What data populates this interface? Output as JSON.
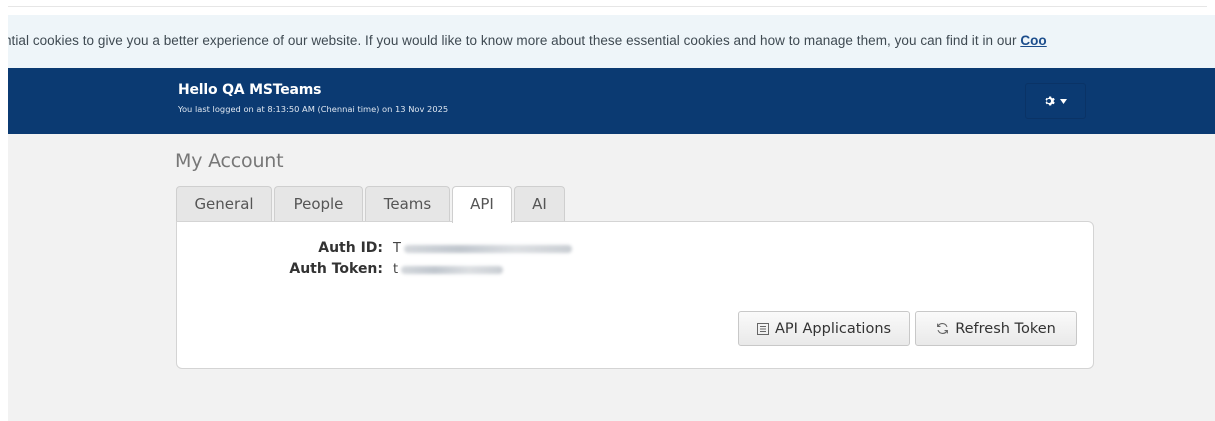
{
  "cookie_banner": {
    "text": "ntial cookies to give you a better experience of our website. If you would like to know more about these essential cookies and how to manage them, you can find it in our ",
    "link_text": "Coo"
  },
  "header": {
    "greeting": "Hello QA MSTeams",
    "last_login": "You last logged on at 8:13:50 AM (Chennai time) on 13 Nov 2025",
    "settings_icon": "gear-icon",
    "background_color": "#0b3a72"
  },
  "page": {
    "title": "My Account",
    "tabs": [
      {
        "label": "General",
        "active": false
      },
      {
        "label": "People",
        "active": false
      },
      {
        "label": "Teams",
        "active": false
      },
      {
        "label": "API",
        "active": true
      },
      {
        "label": "AI",
        "active": false
      }
    ]
  },
  "api_panel": {
    "auth_id_label": "Auth ID:",
    "auth_id_value": "T",
    "auth_token_label": "Auth Token:",
    "auth_token_value": "t",
    "api_applications_label": "API Applications",
    "api_applications_icon": "list-icon",
    "refresh_token_label": "Refresh Token",
    "refresh_token_icon": "refresh-icon"
  }
}
